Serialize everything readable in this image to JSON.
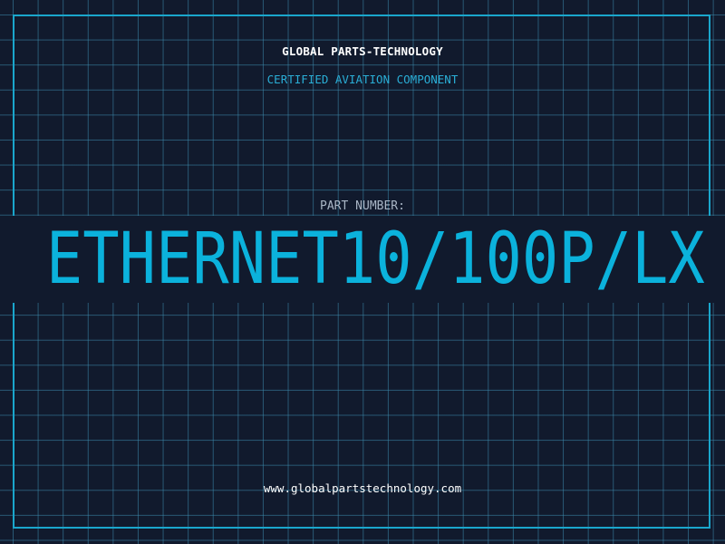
{
  "header": {
    "company": "GLOBAL PARTS-TECHNOLOGY",
    "subtitle": "CERTIFIED AVIATION COMPONENT"
  },
  "part": {
    "label": "PART NUMBER:",
    "number": "ETHERNET10/100P/LX"
  },
  "footer": {
    "website": "www.globalpartstechnology.com"
  },
  "colors": {
    "background": "#111a2d",
    "grid": "#3c8caf",
    "accent": "#0bb2dc",
    "frame": "#1aa6cc"
  }
}
